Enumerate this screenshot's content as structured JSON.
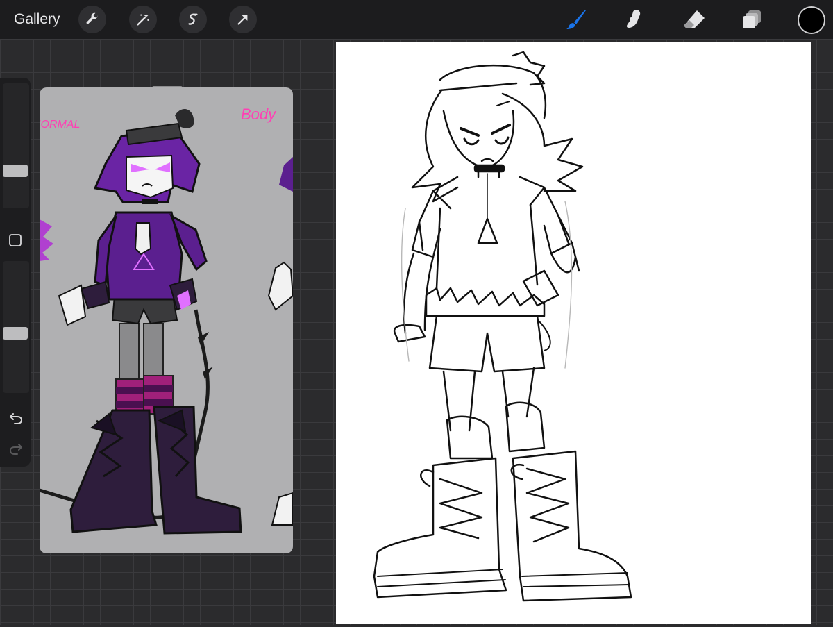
{
  "toolbar": {
    "gallery_label": "Gallery",
    "actions": [
      "wrench-icon",
      "magic-wand-icon",
      "selection-icon",
      "transform-icon"
    ],
    "tools": [
      "brush-icon",
      "smudge-icon",
      "eraser-icon",
      "layers-icon"
    ],
    "active_tool": "brush-icon",
    "current_color": "#000000",
    "accent_color": "#1a73e8"
  },
  "sidebar": {
    "brush_size_level": 0.28,
    "opacity_level": 0.45,
    "modify_button_icon": "square-icon",
    "undo_icon": "undo-icon",
    "redo_icon": "redo-icon"
  },
  "reference": {
    "label_left": "NORMAL",
    "label_right": "Body",
    "label_color": "#ff3fb4",
    "palette": {
      "purple": "#5b1f8f",
      "glow": "#e070ff",
      "dark": "#2a1a3a",
      "stripe": "#a0207a"
    }
  },
  "canvas": {
    "background": "#ffffff",
    "line_color": "#111111"
  }
}
